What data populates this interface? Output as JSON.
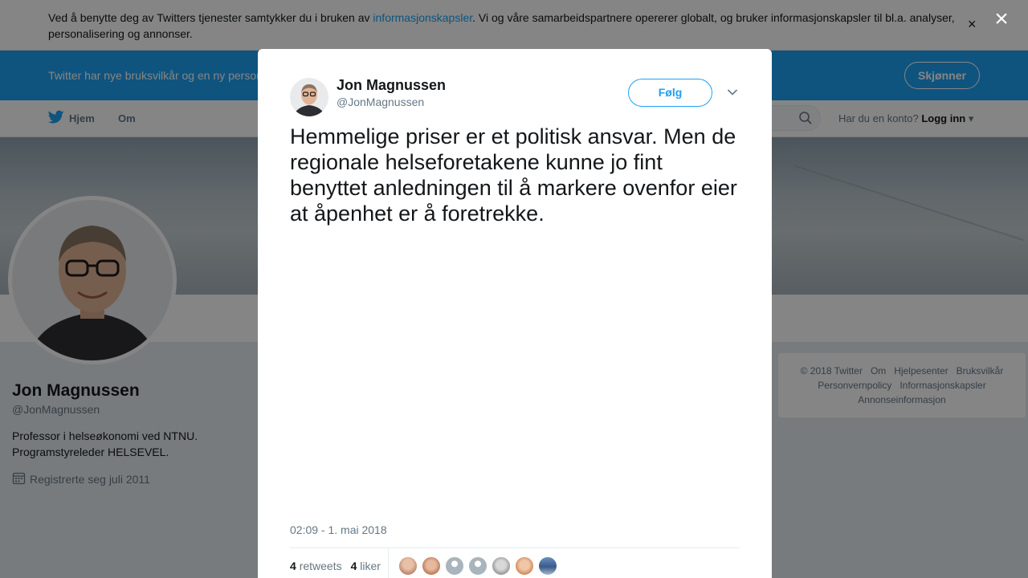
{
  "cookie_bar": {
    "text_before": "Ved å benytte deg av Twitters tjenester samtykker du i bruken av ",
    "link": "informasjonskapsler",
    "text_after": ". Vi og våre samarbeidspartnere opererer globalt, og bruker informasjonskapsler til bl.a. analyser, personalisering og annonser.",
    "close": "×"
  },
  "terms_bar": {
    "text": "Twitter har nye bruksvilkår og en ny personvernpolicy",
    "button": "Skjønner"
  },
  "topnav": {
    "home": "Hjem",
    "about": "Om",
    "login_prompt": "Har du en konto?",
    "login": "Logg inn"
  },
  "profile": {
    "name": "Jon Magnussen",
    "handle": "@JonMagnussen",
    "bio_line1": "Professor i helseøkonomi ved NTNU.",
    "bio_line2": "Programstyreleder HELSEVEL.",
    "joined": "Registrerte seg juli 2011"
  },
  "footer": {
    "links": [
      "© 2018 Twitter",
      "Om",
      "Hjelpesenter",
      "Bruksvilkår",
      "Personvernpolicy",
      "Informasjonskapsler",
      "Annonseinformasjon"
    ]
  },
  "overlay": {
    "close": "×"
  },
  "tweet": {
    "author_name": "Jon Magnussen",
    "author_handle": "@JonMagnussen",
    "follow_label": "Følg",
    "text": "Hemmelige priser er et politisk ansvar. Men de regionale helseforetakene kunne jo fint benyttet anledningen til å markere ovenfor eier at åpenhet er å foretrekke.",
    "timestamp": "02:09 - 1. mai 2018",
    "retweet_count": "4",
    "retweet_label": "retweets",
    "like_count": "4",
    "like_label": "liker"
  },
  "colors": {
    "brand": "#1da1f2",
    "text": "#14171a",
    "muted": "#657786"
  }
}
